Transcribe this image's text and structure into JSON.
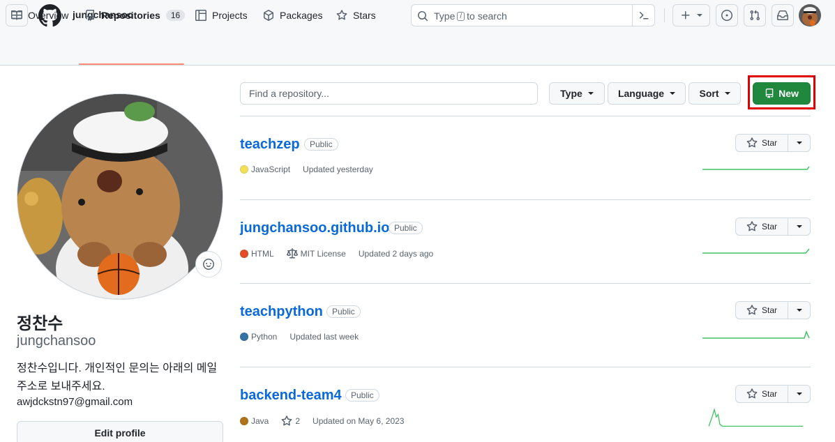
{
  "header": {
    "username": "jungchansoo",
    "search_prefix": "Type",
    "search_key": "/",
    "search_suffix": "to search"
  },
  "tabs": [
    {
      "label": "Overview"
    },
    {
      "label": "Repositories",
      "count": "16"
    },
    {
      "label": "Projects"
    },
    {
      "label": "Packages"
    },
    {
      "label": "Stars"
    }
  ],
  "profile": {
    "display_name": "정찬수",
    "login": "jungchansoo",
    "bio": "정찬수입니다. 개인적인 문의는 아래의 메일 주소로 보내주세요.",
    "email": "awjdckstn97@gmail.com",
    "edit_label": "Edit profile"
  },
  "filters": {
    "find_placeholder": "Find a repository...",
    "type_label": "Type",
    "language_label": "Language",
    "sort_label": "Sort",
    "new_label": "New"
  },
  "repos": [
    {
      "name": "teachzep",
      "visibility": "Public",
      "language": "JavaScript",
      "language_color": "#f1e05a",
      "updated": "Updated yesterday",
      "star_label": "Star"
    },
    {
      "name": "jungchansoo.github.io",
      "visibility": "Public",
      "language": "HTML",
      "language_color": "#e34c26",
      "license": "MIT License",
      "updated": "Updated 2 days ago",
      "star_label": "Star"
    },
    {
      "name": "teachpython",
      "visibility": "Public",
      "language": "Python",
      "language_color": "#3572A5",
      "updated": "Updated last week",
      "star_label": "Star"
    },
    {
      "name": "backend-team4",
      "visibility": "Public",
      "language": "Java",
      "language_color": "#b07219",
      "stars": "2",
      "updated": "Updated on May 6, 2023",
      "star_label": "Star"
    }
  ],
  "icons": [
    "hamburger-icon",
    "github-logo",
    "search-icon",
    "command-palette-icon",
    "plus-icon",
    "issues-icon",
    "pull-requests-icon",
    "inbox-icon",
    "book-icon",
    "repo-icon",
    "project-icon",
    "package-icon",
    "star-icon",
    "smiley-icon",
    "law-icon"
  ],
  "colors": {
    "accent_underline": "#fd8c73",
    "new_button": "#1f883d",
    "link": "#0969da",
    "highlight_box": "#e00000",
    "sparkline": "#40c463"
  }
}
